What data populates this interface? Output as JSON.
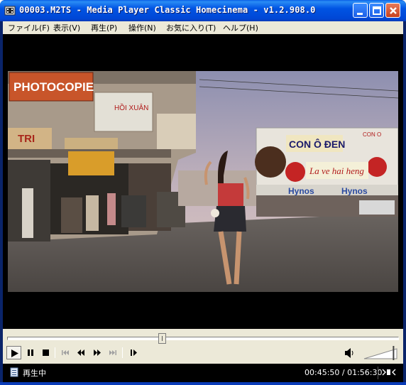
{
  "window": {
    "title": "00003.M2TS - Media Player Classic Homecinema - v1.2.908.0",
    "buttons": {
      "minimize": "minimize",
      "maximize": "maximize",
      "close": "close"
    }
  },
  "menu": {
    "items": [
      {
        "label": "ファイル(F)"
      },
      {
        "label": "表示(V)"
      },
      {
        "label": "再生(P)"
      },
      {
        "label": "操作(N)"
      },
      {
        "label": "お気に入り(T)"
      },
      {
        "label": "ヘルプ(H)"
      }
    ]
  },
  "video": {
    "signs": {
      "photocopie": "PHOTOCOPIE",
      "hoi_xuan": "HỒI XUÂN",
      "tri": "TRI",
      "con_o_den": "CON Ô ĐEN",
      "hynos": "Hynos",
      "la_ve_hai_heng": "La ve hai heng",
      "con_o": "CON O"
    }
  },
  "seek": {
    "position_fraction": 0.396
  },
  "controls": {
    "icons": [
      "play-icon",
      "pause-icon",
      "stop-icon",
      "skip-back-icon",
      "rewind-icon",
      "fast-forward-icon",
      "skip-forward-icon",
      "frame-step-icon",
      "volume-icon"
    ],
    "volume_fraction": 0.9
  },
  "status": {
    "state": "再生中",
    "time": "00:45:50 / 01:56:30"
  },
  "colors": {
    "titlebar": "#0054e3",
    "chrome": "#ece9d8",
    "video_bg": "#000000",
    "status_text": "#ffffff"
  }
}
